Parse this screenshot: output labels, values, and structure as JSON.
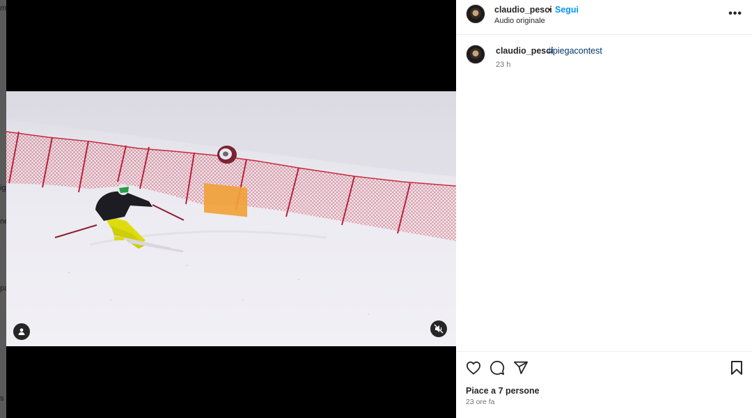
{
  "backdrop": {
    "fragments": [
      "m",
      "ig",
      "ne",
      "pa",
      "s"
    ]
  },
  "post": {
    "author": "claudio_pesci",
    "separator": "•",
    "follow_label": "Segui",
    "audio": "Audio originale",
    "more_label": "•••",
    "caption_author": "claudio_pesci",
    "caption_hashtag": "#piegacontest",
    "caption_time": "23 h",
    "likes": "Piace a 7 persone",
    "date": "23 ore fa"
  },
  "icons": {
    "like": "heart-icon",
    "comment": "comment-bubble-icon",
    "share": "paper-plane-icon",
    "save": "bookmark-icon",
    "tag": "user-tag-icon",
    "mute": "speaker-muted-icon",
    "options": "ellipsis-icon"
  },
  "colors": {
    "follow": "#0095f6",
    "hashtag": "#00376b",
    "netting": "#d43a4f",
    "skier_pants": "#e6e000"
  }
}
